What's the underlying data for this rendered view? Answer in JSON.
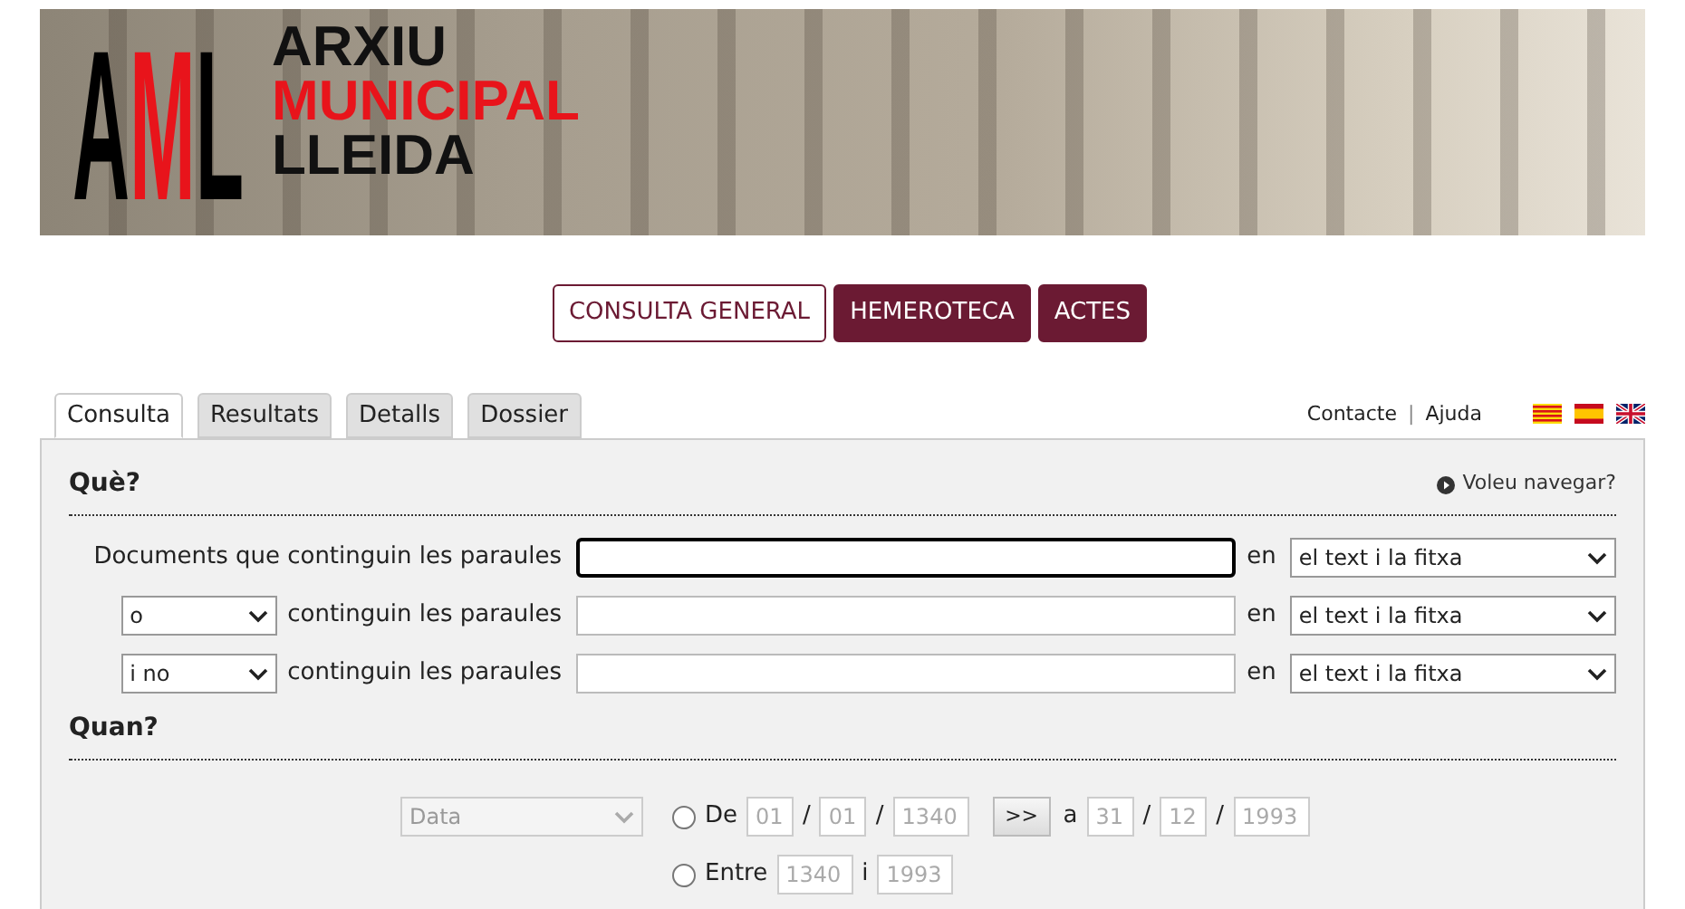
{
  "banner": {
    "logo": {
      "mark": "AML",
      "lines": [
        {
          "text": "ARXIU",
          "color": "#111111"
        },
        {
          "text": "MUNICIPAL",
          "color": "#e8141b"
        },
        {
          "text": "LLEIDA",
          "color": "#111111"
        }
      ]
    }
  },
  "nav": [
    {
      "label": "CONSULTA GENERAL",
      "selected": true
    },
    {
      "label": "HEMEROTECA",
      "selected": false
    },
    {
      "label": "ACTES",
      "selected": false
    }
  ],
  "tabs": [
    {
      "label": "Consulta",
      "selected": true
    },
    {
      "label": "Resultats",
      "selected": false
    },
    {
      "label": "Detalls",
      "selected": false
    },
    {
      "label": "Dossier",
      "selected": false
    }
  ],
  "top_links": [
    "Contacte",
    "Ajuda"
  ],
  "top_links_separator": "|",
  "languages": [
    {
      "kind": "ca"
    },
    {
      "kind": "es"
    },
    {
      "kind": "en"
    }
  ],
  "what": {
    "title": "Què?",
    "browse_link": "Voleu navegar?",
    "rows": [
      {
        "kind": "label",
        "label": "Documents que continguin les paraules",
        "in_label": "en",
        "scope": "el text i la fitxa",
        "focused": true
      },
      {
        "kind": "operator",
        "operator": "o",
        "label": "continguin les paraules",
        "in_label": "en",
        "scope": "el text i la fitxa",
        "focused": false
      },
      {
        "kind": "operator",
        "operator": "i no",
        "label": "continguin les paraules",
        "in_label": "en",
        "scope": "el text i la fitxa",
        "focused": false
      }
    ]
  },
  "when": {
    "title": "Quan?",
    "date_type": "Data",
    "from": {
      "selected": false,
      "label": "De",
      "day": "01",
      "month": "01",
      "year": "1340",
      "separators": [
        "/",
        "/"
      ],
      "to_separators": [
        "/",
        "/"
      ],
      "go": ">>",
      "to_label": "a",
      "to_day": "31",
      "to_month": "12",
      "to_year": "1993"
    },
    "between": {
      "selected": false,
      "label": "Entre",
      "start": "1340",
      "and_label": "i",
      "end": "1993"
    }
  }
}
